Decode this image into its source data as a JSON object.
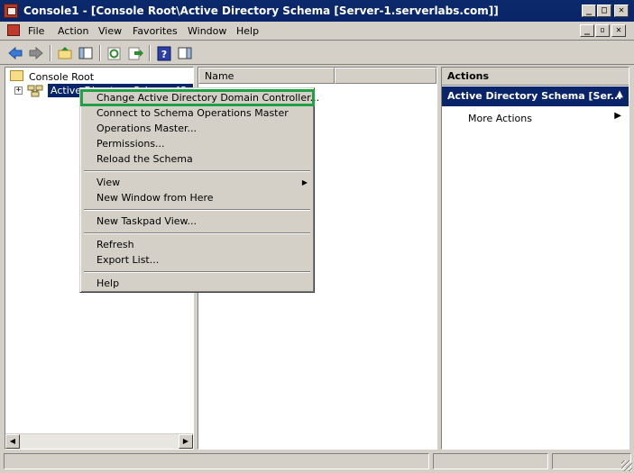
{
  "window": {
    "title": "Console1 - [Console Root\\Active Directory Schema [Server-1.serverlabs.com]]",
    "controls": [
      "_",
      "□",
      "✕"
    ],
    "inner_controls": [
      "_",
      "▫",
      "✕"
    ]
  },
  "menubar": {
    "items": [
      "File",
      "Action",
      "View",
      "Favorites",
      "Window",
      "Help"
    ]
  },
  "toolbar": {
    "buttons": [
      "back-icon",
      "forward-icon",
      "up-folder-icon",
      "show-hide-tree-icon",
      "refresh-icon",
      "export-icon",
      "help-icon",
      "action-pane-icon"
    ]
  },
  "tree": {
    "root_label": "Console Root",
    "selected_label": "Active Directory Schema [Server-1.serverlabs.com]"
  },
  "list": {
    "columns": [
      "Name",
      ""
    ]
  },
  "actions_pane": {
    "header": "Actions",
    "section_title": "Active Directory Schema [Ser...",
    "items": [
      "More Actions"
    ]
  },
  "context_menu": {
    "items": [
      "Change Active Directory Domain Controller...",
      "Connect to Schema Operations Master",
      "Operations Master...",
      "Permissions...",
      "Reload the Schema",
      "View",
      "New Window from Here",
      "New Taskpad View...",
      "Refresh",
      "Export List...",
      "Help"
    ],
    "highlighted_index": 0,
    "highlight_color": "#22a046"
  },
  "colors": {
    "title_bar": "#0a246a",
    "selection": "#0a246a",
    "chrome": "#d4d0c8"
  }
}
